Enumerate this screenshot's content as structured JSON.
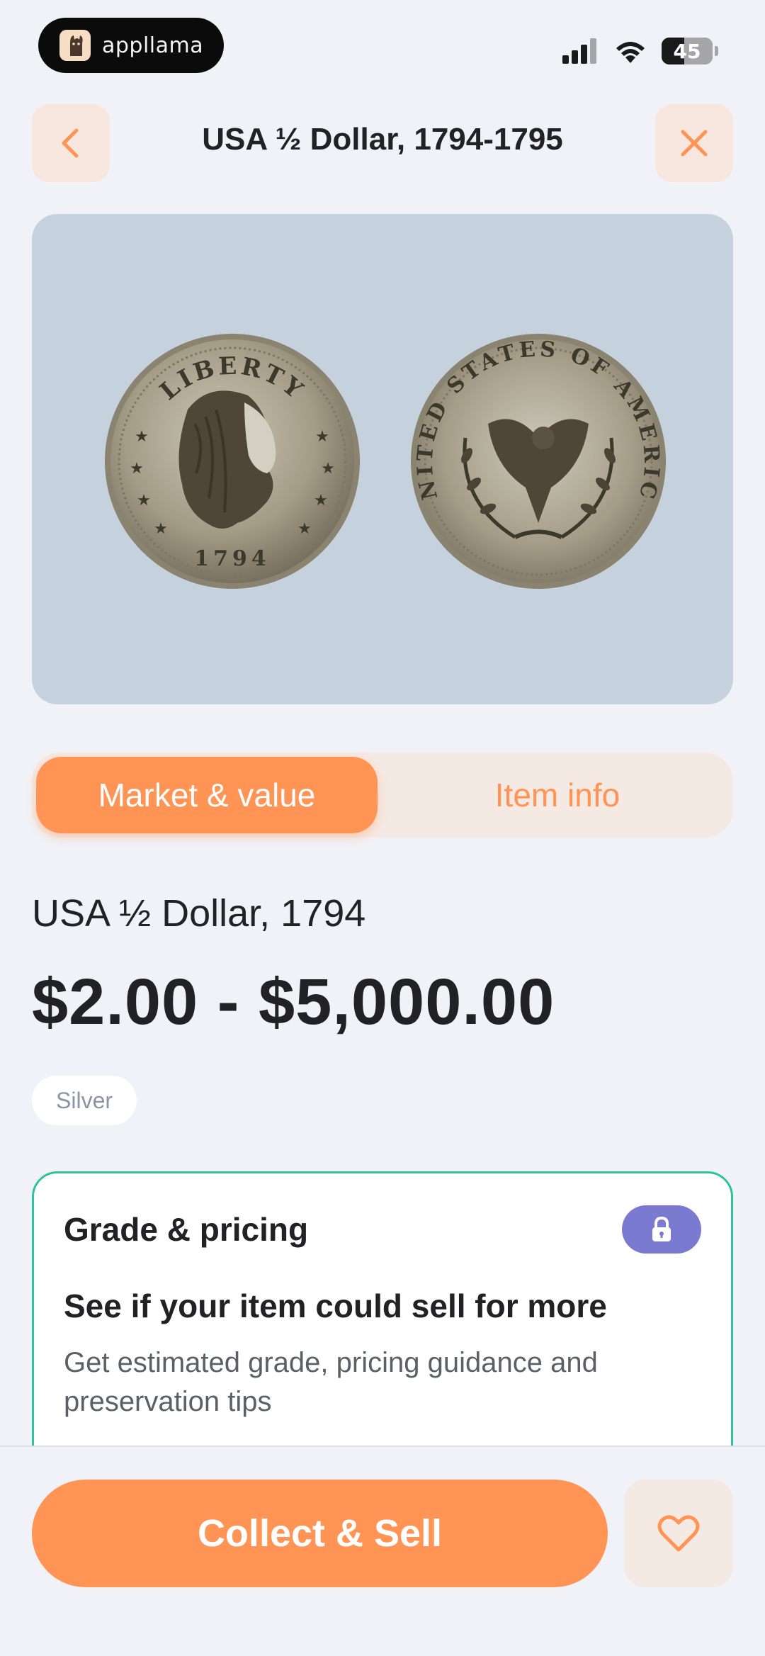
{
  "status_bar": {
    "app_name": "appllama",
    "battery": "45",
    "battery_level": 0.45,
    "icons": [
      "cellular-signal-icon",
      "wifi-icon",
      "battery-icon"
    ]
  },
  "header": {
    "title": "USA ½ Dollar, 1794-1795",
    "back_icon": "chevron-left-icon",
    "close_icon": "close-icon"
  },
  "image": {
    "obverse_legend": "LIBERTY",
    "obverse_date": "1794",
    "reverse_legend": "UNITED STATES OF AMERICA"
  },
  "tabs": [
    {
      "label": "Market & value",
      "active": true
    },
    {
      "label": "Item info",
      "active": false
    }
  ],
  "item": {
    "name": "USA ½ Dollar, 1794",
    "price_range": "$2.00 - $5,000.00",
    "material": "Silver"
  },
  "grade_card": {
    "title": "Grade & pricing",
    "heading": "See if your item could sell for more",
    "description": "Get estimated grade, pricing guidance and preservation tips",
    "lock_icon": "lock-icon"
  },
  "bottom_bar": {
    "primary_label": "Collect & Sell",
    "favorite_icon": "heart-icon"
  },
  "colors": {
    "accent": "#ff9455",
    "accent_soft": "#f5e9e3",
    "card_border": "#2fc29c",
    "lock_badge": "#7a7bd0",
    "image_bg": "#c5d1dd",
    "page_bg": "#f1f2f7"
  }
}
